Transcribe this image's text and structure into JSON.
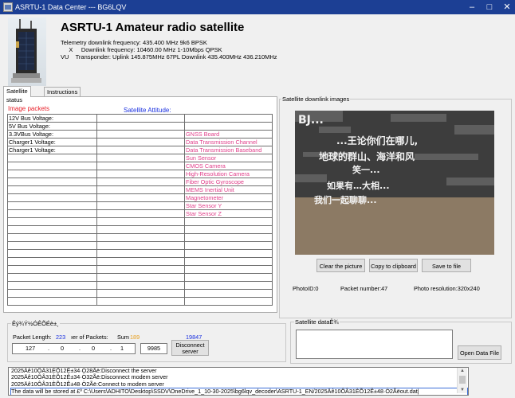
{
  "window": {
    "title": "ASRTU-1 Data Center --- BG6LQV",
    "minimize_icon": "minimize-icon",
    "maximize_icon": "maximize-icon",
    "close_icon": "close-icon"
  },
  "header": {
    "title": "ASRTU-1  Amateur radio satellite",
    "telemetry": "Telemetry downlink frequency: 435.400 MHz 9k6 BPSK",
    "x_band": "     X     Downlink frequency: 10460.00 MHz 1-10Mbps QPSK",
    "vu": "VU    Transponder: Uplink 145.875MHz 67PL Downlink 435.400MHz 436.210MHz"
  },
  "tabs": [
    "Satellite status",
    "Instructions"
  ],
  "status_panel": {
    "image_packets_label": "Image packets",
    "attitude_label": "Satellite Attitude:",
    "rows": [
      [
        "12V Bus Voltage:",
        "",
        ""
      ],
      [
        "5V  Bus Voltage:",
        "",
        ""
      ],
      [
        "3.3VBus Voltage:",
        "",
        "GNSS Board"
      ],
      [
        "Charger1 Voltage:",
        "",
        "Data Transmission Channel"
      ],
      [
        "Charger1 Voltage:",
        "",
        "Data Transmission Baseband"
      ],
      [
        "",
        "",
        "Sun Sensor"
      ],
      [
        "",
        "",
        "CMOS Camera"
      ],
      [
        "",
        "",
        "High-Resolution Camera"
      ],
      [
        "",
        "",
        "Fiber Optic Gyroscope"
      ],
      [
        "",
        "",
        "MEMS Inertial Unit"
      ],
      [
        "",
        "",
        "Magnetometer"
      ],
      [
        "",
        "",
        "Star Sensor Y"
      ],
      [
        "",
        "",
        "Star Sensor Z"
      ],
      [
        "",
        "",
        ""
      ],
      [
        "",
        "",
        ""
      ],
      [
        "",
        "",
        ""
      ],
      [
        "",
        "",
        ""
      ],
      [
        "",
        "",
        ""
      ],
      [
        "",
        "",
        ""
      ],
      [
        "",
        "",
        ""
      ],
      [
        "",
        "",
        ""
      ],
      [
        "",
        "",
        ""
      ],
      [
        "",
        "",
        ""
      ],
      [
        "",
        "",
        ""
      ]
    ]
  },
  "downlink": {
    "caption": "Satellite downlink images",
    "image_text": [
      "BJ...",
      "...王论你们在哪儿,",
      "地球的群山、海洋和风",
      "笑一...",
      "如果有…大相...",
      "我们一起聊聊..."
    ],
    "buttons": {
      "clear": "Clear the picture",
      "copy": "Copy to clipboard",
      "save": "Save to file"
    },
    "photo_id": "PhotoID:0",
    "packet_number": "Packet number:47",
    "photo_resolution": "Photo resolution:320x240"
  },
  "receiver": {
    "caption": "Êý¾Ý½ÓÊÕÉè±¸",
    "packet_length_label": "Packet Length:",
    "packet_length_value": "223",
    "packets_label": "ıer of Packets:",
    "sum_label": "Sum",
    "sum_value": "189",
    "value_blue": "19847",
    "ip": [
      "127",
      "0",
      "0",
      "1"
    ],
    "port": "9985",
    "disconnect_label": "Disconnect server"
  },
  "satellite_data": {
    "caption": "Satellite dataÊ¾",
    "open_label": "Open Data File"
  },
  "log": [
    "2025Äê10ÔÂ31ÈÕ12Ê±34·Ö28Ãë:Disconnect the server",
    "2025Äê10ÔÂ31ÈÕ12Ê±34·Ö32Ãë:Disconnect  modem server",
    "2025Äê10ÔÂ31ÈÕ12Ê±48·Ö2Ãë:Connect to  modem server",
    "The data will be stored at £º C:\\Users\\ADHITO\\Desktop\\SSDV\\OneDrive_1_10-30-2025\\bg6lqv_decoder\\ASRTU-1_EN/2025Äê10ÔÂ31ÈÕ12Ê±48·Ö2Ãëout.dat|"
  ],
  "colors": {
    "titlebar": "#1c3f94",
    "red_label": "#e8202a",
    "blue_label": "#1a30e0",
    "pink_text": "#e0408a"
  }
}
